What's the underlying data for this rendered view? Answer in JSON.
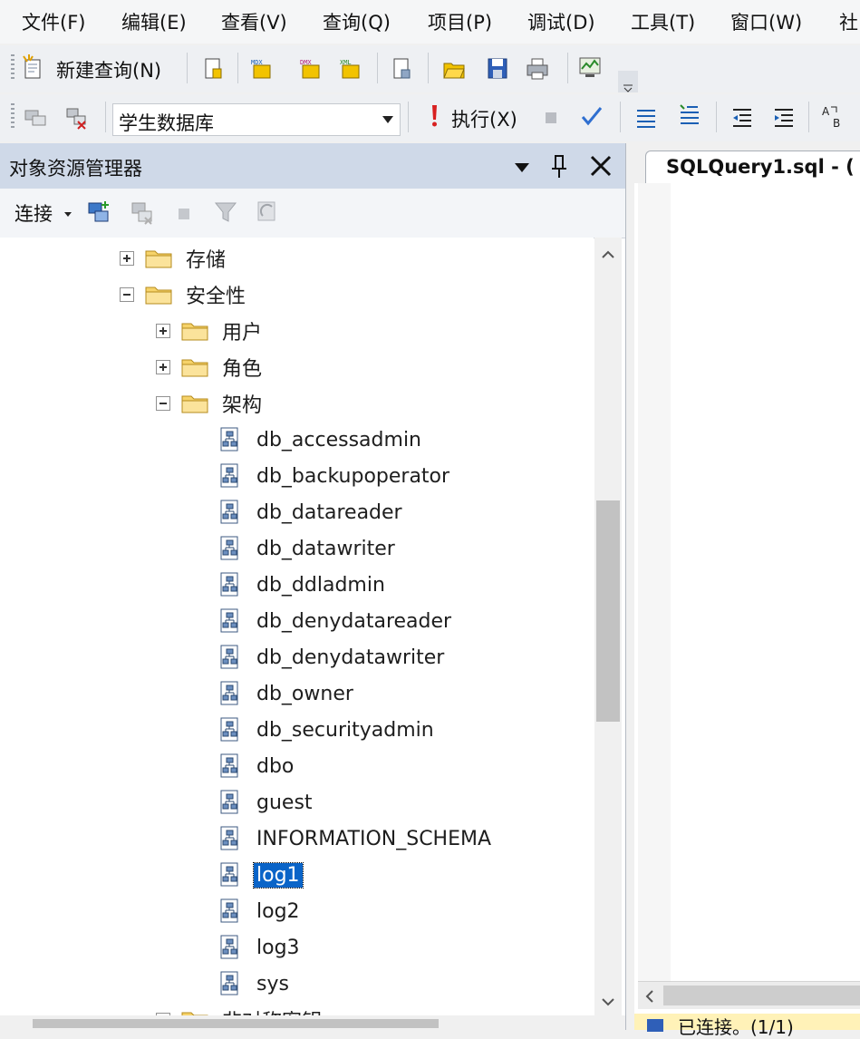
{
  "menubar": {
    "items": [
      "文件(F)",
      "编辑(E)",
      "查看(V)",
      "查询(Q)",
      "项目(P)",
      "调试(D)",
      "工具(T)",
      "窗口(W)",
      "社"
    ]
  },
  "toolbar_standard": {
    "new_query_label": "新建查询(N)"
  },
  "toolbar_sql": {
    "database": "学生数据库",
    "execute_label": "执行(X)"
  },
  "object_explorer": {
    "title": "对象资源管理器",
    "connect_label": "连接",
    "tree": [
      {
        "label": "存储",
        "expander": "plus"
      },
      {
        "label": "安全性",
        "expander": "minus"
      },
      {
        "label": "用户",
        "expander": "plus"
      },
      {
        "label": "角色",
        "expander": "plus"
      },
      {
        "label": "架构",
        "expander": "minus"
      },
      {
        "label": "db_accessadmin"
      },
      {
        "label": "db_backupoperator"
      },
      {
        "label": "db_datareader"
      },
      {
        "label": "db_datawriter"
      },
      {
        "label": "db_ddladmin"
      },
      {
        "label": "db_denydatareader"
      },
      {
        "label": "db_denydatawriter"
      },
      {
        "label": "db_owner"
      },
      {
        "label": "db_securityadmin"
      },
      {
        "label": "dbo"
      },
      {
        "label": "guest"
      },
      {
        "label": "INFORMATION_SCHEMA"
      },
      {
        "label": "log1",
        "selected": true
      },
      {
        "label": "log2"
      },
      {
        "label": "log3"
      },
      {
        "label": "sys"
      },
      {
        "label": "非对称密钥",
        "expander": "plus"
      }
    ]
  },
  "editor": {
    "tab_label": "SQLQuery1.sql - (",
    "status_text": "已连接。(1/1)"
  },
  "colors": {
    "selection": "#0a64c8",
    "panel_title": "#cfd9e8",
    "status_bar": "#fff2b8"
  }
}
